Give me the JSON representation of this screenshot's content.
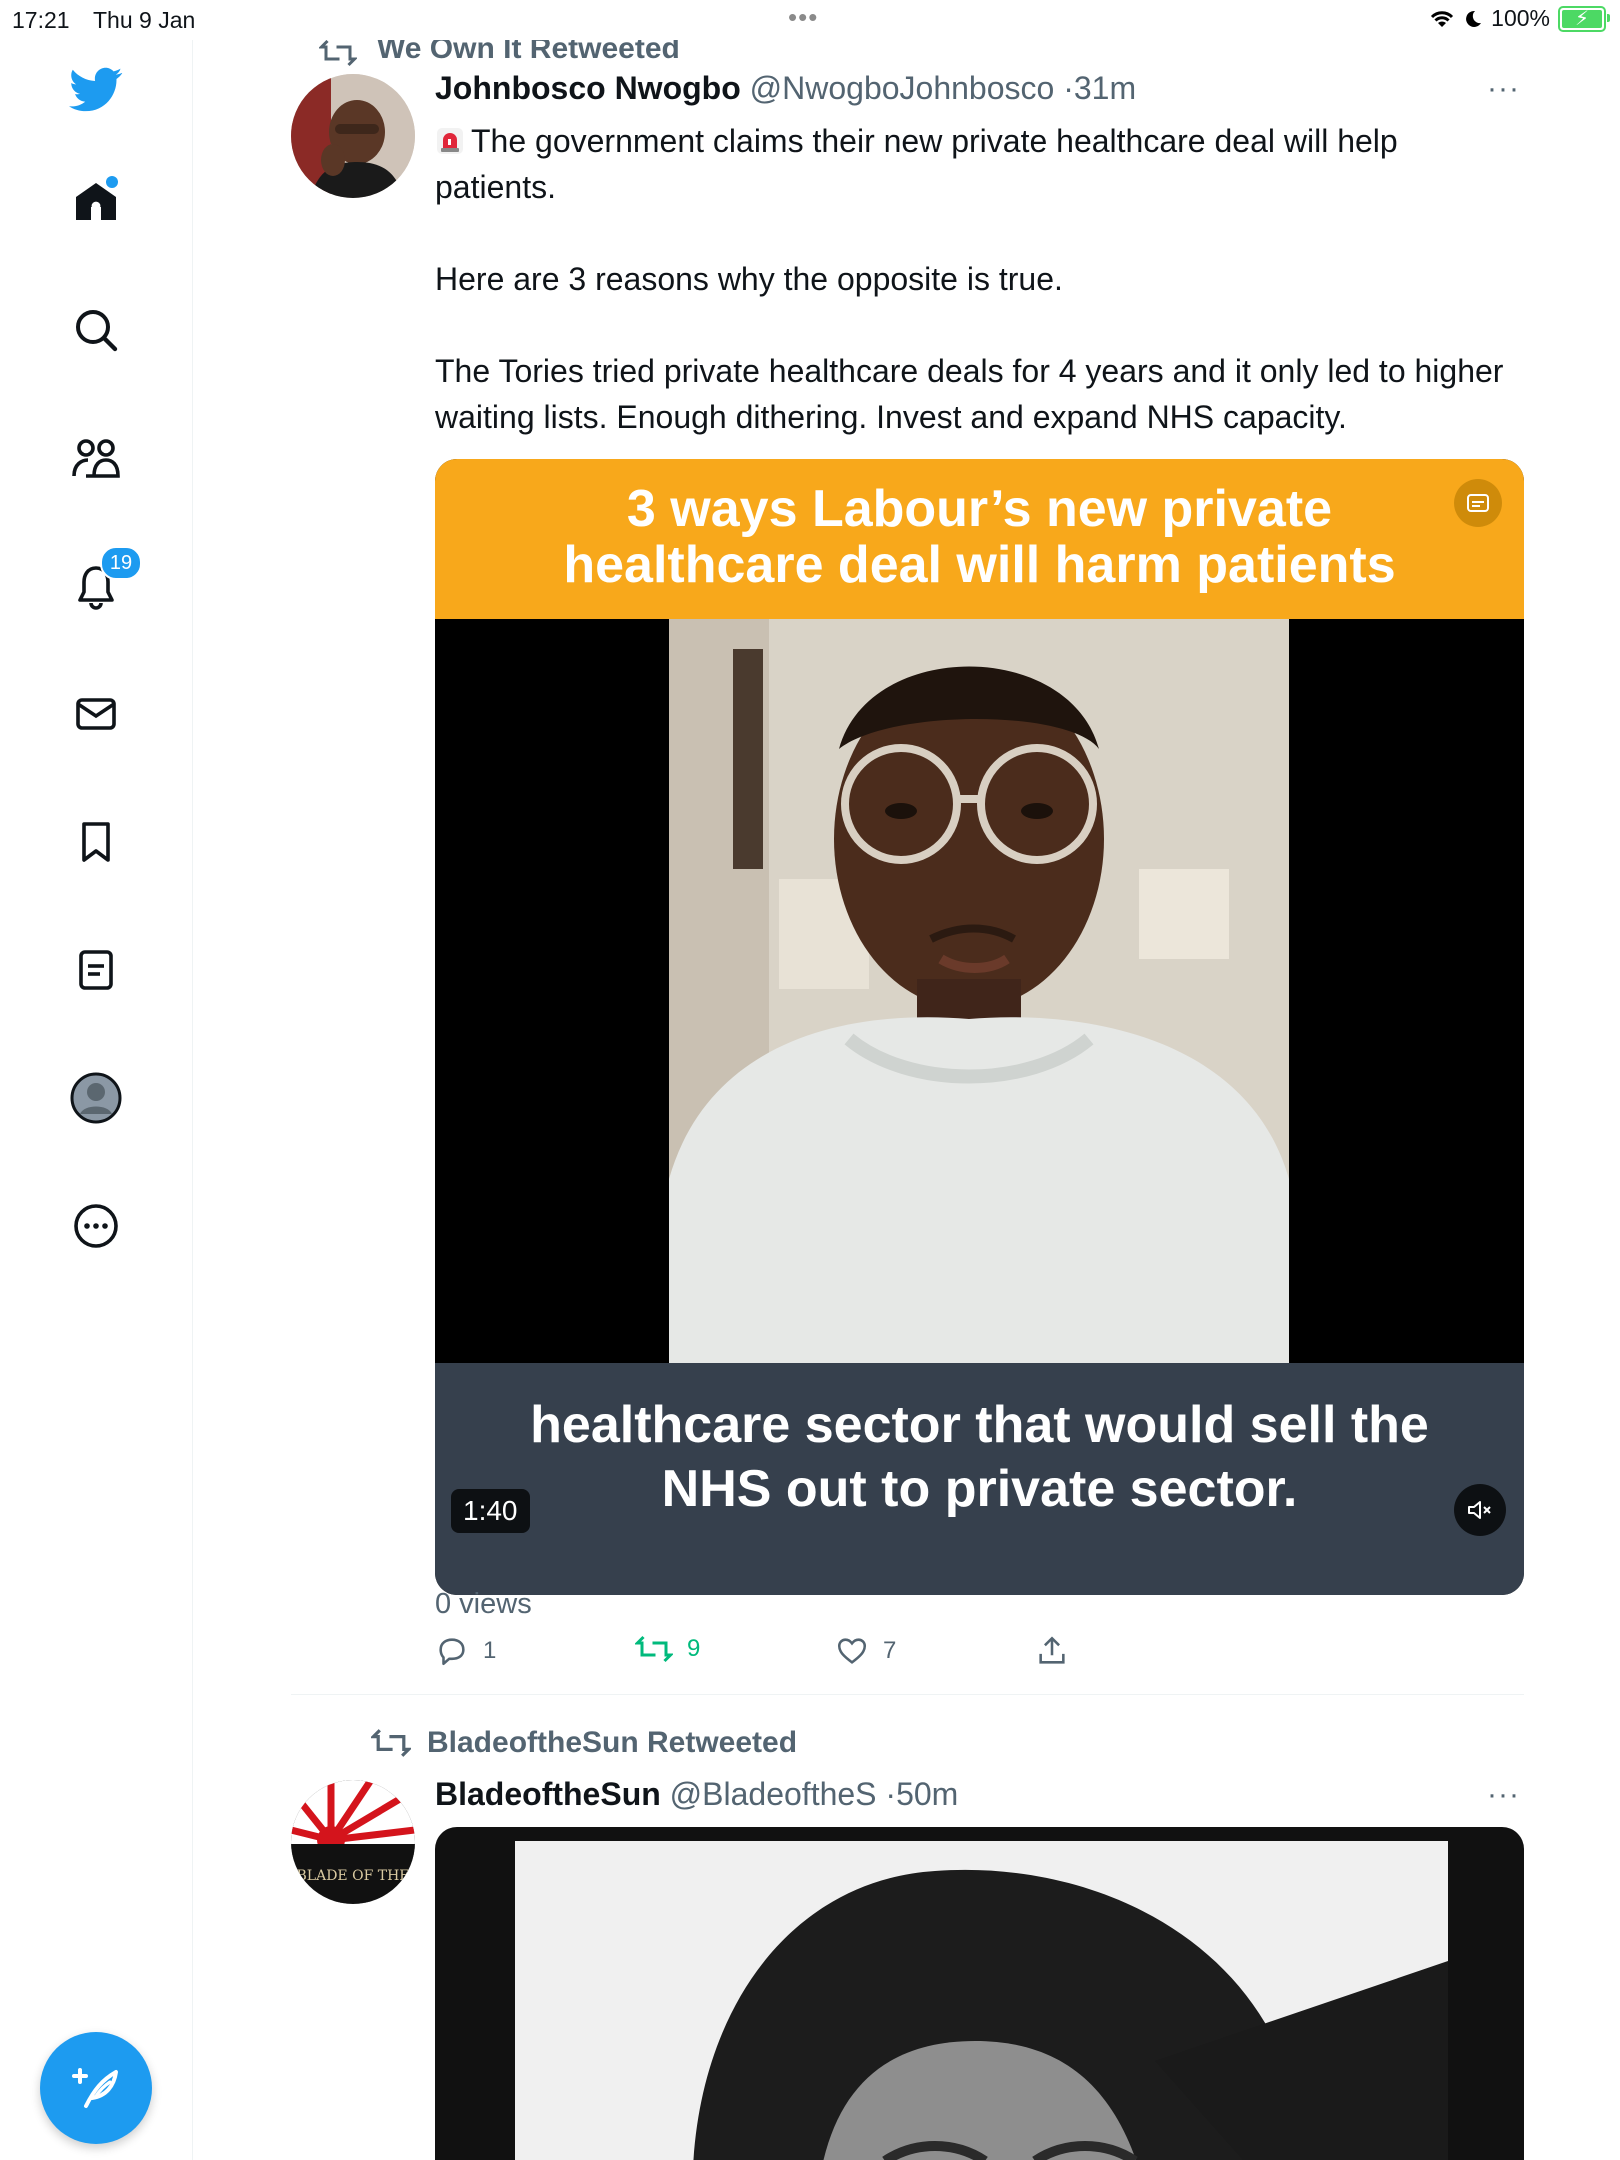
{
  "status_bar": {
    "time": "17:21",
    "date": "Thu 9 Jan",
    "battery": "100%"
  },
  "sidebar": {
    "notifications_count": "19",
    "items": [
      "twitter-logo",
      "home-icon",
      "search-icon",
      "communities-icon",
      "notifications-icon",
      "messages-icon",
      "bookmarks-icon",
      "lists-icon",
      "profile-icon",
      "more-icon"
    ]
  },
  "tweet1": {
    "retweet_context": "We Own It Retweeted",
    "author_name": "Johnbosco Nwogbo",
    "author_handle": "@NwogboJohnbosco",
    "separator": "·",
    "time": "31m",
    "text_line1": "The government claims their new private healthcare deal will help patients.",
    "text_line2": "Here are 3 reasons why the opposite is true.",
    "text_line3": "The Tories tried private healthcare deals for 4 years and it only led to higher waiting lists. Enough dithering. Invest and expand NHS capacity.",
    "video": {
      "banner": "3 ways Labour’s new private healthcare deal will harm patients",
      "caption": "healthcare sector that would sell the NHS out to private sector.",
      "duration": "1:40"
    },
    "views": "0 views",
    "replies": "1",
    "retweets": "9",
    "likes": "7"
  },
  "tweet2": {
    "retweet_context": "BladeoftheSun Retweeted",
    "author_name": "BladeoftheSun",
    "author_handle": "@BladeoftheS",
    "separator": "·",
    "time": "50m",
    "avatar_text": "BLADE OF THE"
  },
  "colors": {
    "accent": "#1d9bf0",
    "retweet_green": "#00ba7c",
    "banner_orange": "#f8a81b",
    "caption_bg": "#36404d",
    "secondary_text": "#536471"
  }
}
